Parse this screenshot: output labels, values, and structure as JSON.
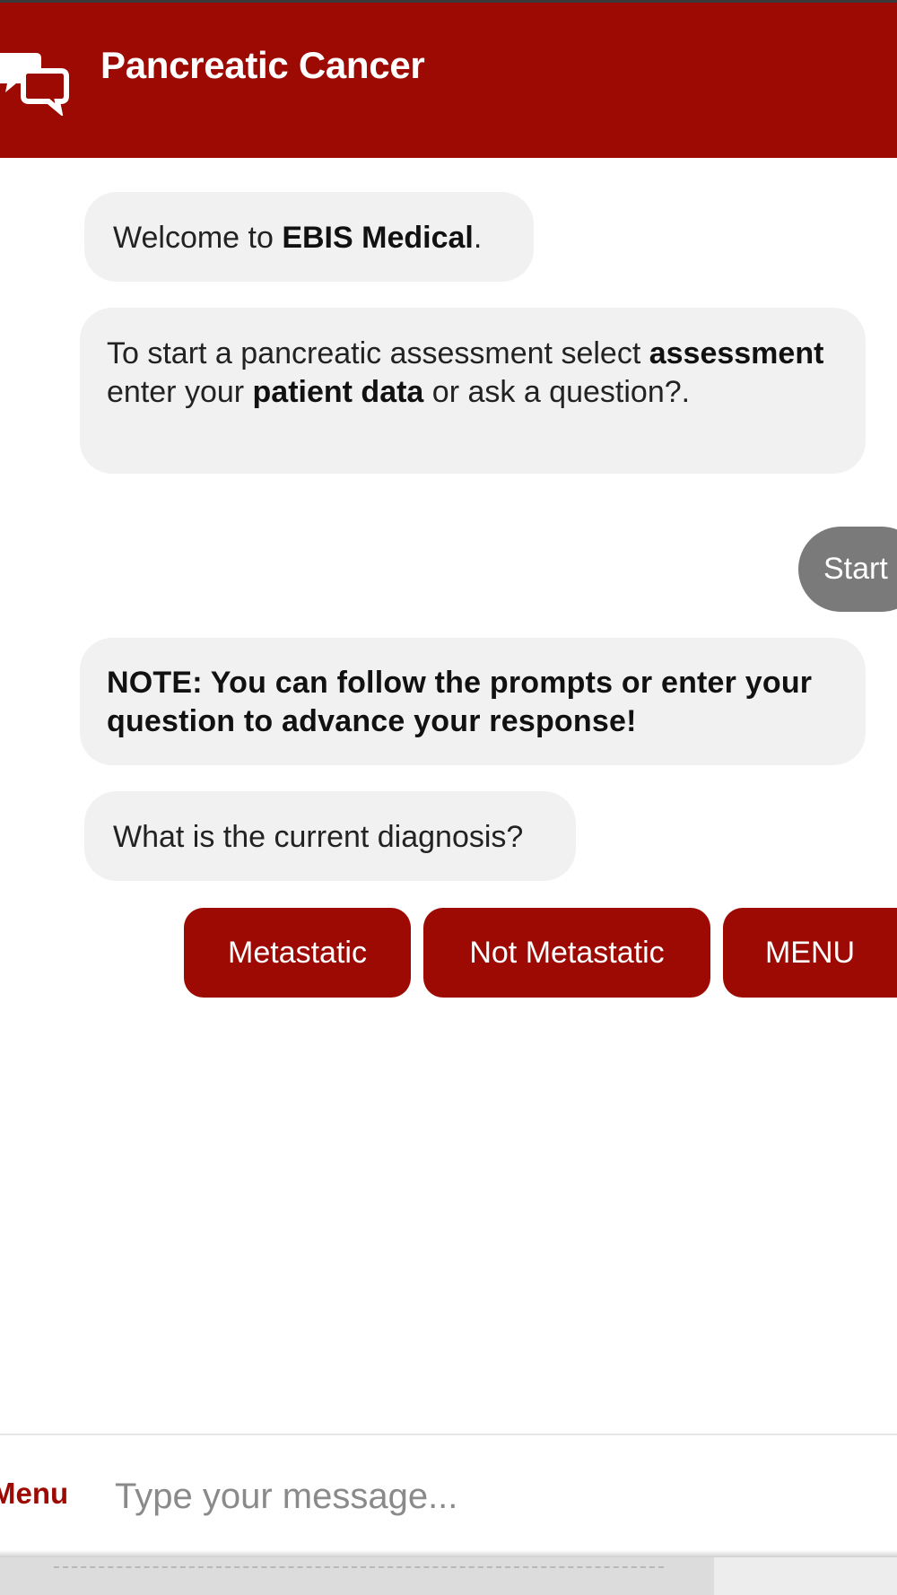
{
  "header": {
    "title": "Pancreatic Cancer",
    "icon": "chat-bubbles-icon",
    "color": "#9c0a03"
  },
  "messages": {
    "welcome": {
      "prefix": "Welcome to ",
      "brand": "EBIS Medical",
      "suffix": "."
    },
    "intro": {
      "part1": "To start a pancreatic assessment select ",
      "bold1": "assessment",
      "part2": " enter your ",
      "bold2": "patient data",
      "part3": " or ask a question?."
    },
    "user_reply": "Start",
    "note": "NOTE: You can follow the prompts or enter your question to advance your response!",
    "question": "What is the current diagnosis?"
  },
  "quick_replies": [
    "Metastatic",
    "Not Metastatic",
    "MENU"
  ],
  "footer": {
    "menu_label": "Menu",
    "input_placeholder": "Type your message...",
    "input_value": ""
  }
}
